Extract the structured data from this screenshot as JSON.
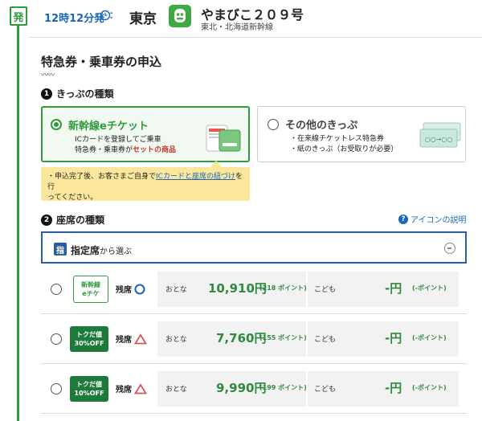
{
  "header": {
    "departure_badge": "発",
    "departure_time": "12時12分発",
    "station": "東京",
    "train_name": "やまびこ２０９号",
    "train_line": "東北・北海道新幹線"
  },
  "page": {
    "title": "特急券・乗車券の申込"
  },
  "step1": {
    "num": "1",
    "label": "きっぷの種類",
    "options": [
      {
        "title": "新幹線eチケット",
        "line1": "ICカードを登録してご乗車",
        "line2_prefix": "特急券・乗車券が",
        "line2_em": "セットの商品",
        "selected": true
      },
      {
        "title": "その他のきっぷ",
        "line1": "・在来線チケットレス特急券",
        "line2": "・紙のきっぷ（お受取りが必要）",
        "selected": false
      }
    ],
    "notice_prefix": "・申込完了後、お客さまご自身で",
    "notice_link": "ICカードと座席の紐づけ",
    "notice_suffix": "を行",
    "notice_line2": "ってください。"
  },
  "step2": {
    "num": "2",
    "label": "座席の種類",
    "help_link": "アイコンの説明",
    "seat_chip": "指",
    "seat_type": "指定席",
    "seat_suffix": "から選ぶ"
  },
  "fares": [
    {
      "badge_line1": "新幹線",
      "badge_line2": "eチケ",
      "badge_style": "outline",
      "remain_label": "残席",
      "remain_status": "circle",
      "adult_label": "おとな",
      "adult_price": "10,910円",
      "adult_points": "(218 ポイント)",
      "child_label": "こども",
      "child_price": "-円",
      "child_points": "(-ポイント)"
    },
    {
      "badge_line1": "トクだ値",
      "badge_line2": "30%OFF",
      "badge_style": "filled",
      "remain_label": "残席",
      "remain_status": "triangle",
      "adult_label": "おとな",
      "adult_price": "7,760円",
      "adult_points": "(155 ポイント)",
      "child_label": "こども",
      "child_price": "-円",
      "child_points": "(-ポイント)"
    },
    {
      "badge_line1": "トクだ値",
      "badge_line2": "10%OFF",
      "badge_style": "filled",
      "remain_label": "残席",
      "remain_status": "triangle",
      "adult_label": "おとな",
      "adult_price": "9,990円",
      "adult_points": "(199 ポイント)",
      "child_label": "こども",
      "child_price": "-円",
      "child_points": "(-ポイント)"
    }
  ],
  "colors": {
    "brand_green": "#2f9a3e",
    "price_green": "#2f8a3e",
    "link_blue": "#1a66b8",
    "seat_blue": "#2a5d9e",
    "notice_yellow": "#fbe79b",
    "status_circle": "#1a66b8",
    "status_triangle": "#d9534f"
  }
}
